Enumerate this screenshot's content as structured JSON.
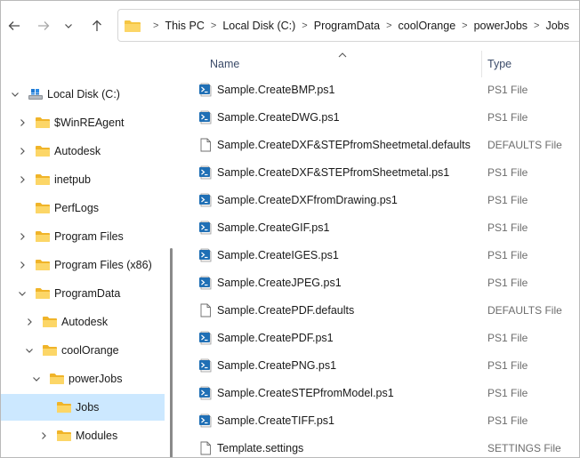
{
  "toolbar": {
    "back_icon": "arrow-left-icon",
    "forward_icon": "arrow-right-icon",
    "recent_icon": "chevron-down-icon",
    "up_icon": "arrow-up-icon"
  },
  "address": {
    "folder_icon": "folder-icon",
    "crumbs": [
      "This PC",
      "Local Disk (C:)",
      "ProgramData",
      "coolOrange",
      "powerJobs",
      "Jobs"
    ]
  },
  "nav": {
    "items": [
      {
        "label": "Local Disk (C:)",
        "icon": "drive-icon",
        "expanded": true
      },
      {
        "label": "$WinREAgent",
        "icon": "folder-icon"
      },
      {
        "label": "Autodesk",
        "icon": "folder-icon"
      },
      {
        "label": "inetpub",
        "icon": "folder-icon"
      },
      {
        "label": "PerfLogs",
        "icon": "folder-icon"
      },
      {
        "label": "Program Files",
        "icon": "folder-icon"
      },
      {
        "label": "Program Files (x86)",
        "icon": "folder-icon"
      },
      {
        "label": "ProgramData",
        "icon": "folder-icon",
        "expanded": true
      },
      {
        "label": "Autodesk",
        "icon": "folder-icon"
      },
      {
        "label": "coolOrange",
        "icon": "folder-icon",
        "expanded": true
      },
      {
        "label": "powerJobs",
        "icon": "folder-icon",
        "expanded": true
      },
      {
        "label": "Jobs",
        "icon": "folder-icon",
        "selected": true
      },
      {
        "label": "Modules",
        "icon": "folder-icon"
      }
    ]
  },
  "filelist": {
    "columns": {
      "name": "Name",
      "type": "Type"
    },
    "files": [
      {
        "name": "Sample.CreateBMP.ps1",
        "type": "PS1 File",
        "icon": "powershell-script-icon"
      },
      {
        "name": "Sample.CreateDWG.ps1",
        "type": "PS1 File",
        "icon": "powershell-script-icon"
      },
      {
        "name": "Sample.CreateDXF&STEPfromSheetmetal.defaults",
        "type": "DEFAULTS File",
        "icon": "blank-file-icon"
      },
      {
        "name": "Sample.CreateDXF&STEPfromSheetmetal.ps1",
        "type": "PS1 File",
        "icon": "powershell-script-icon"
      },
      {
        "name": "Sample.CreateDXFfromDrawing.ps1",
        "type": "PS1 File",
        "icon": "powershell-script-icon"
      },
      {
        "name": "Sample.CreateGIF.ps1",
        "type": "PS1 File",
        "icon": "powershell-script-icon"
      },
      {
        "name": "Sample.CreateIGES.ps1",
        "type": "PS1 File",
        "icon": "powershell-script-icon"
      },
      {
        "name": "Sample.CreateJPEG.ps1",
        "type": "PS1 File",
        "icon": "powershell-script-icon"
      },
      {
        "name": "Sample.CreatePDF.defaults",
        "type": "DEFAULTS File",
        "icon": "blank-file-icon"
      },
      {
        "name": "Sample.CreatePDF.ps1",
        "type": "PS1 File",
        "icon": "powershell-script-icon"
      },
      {
        "name": "Sample.CreatePNG.ps1",
        "type": "PS1 File",
        "icon": "powershell-script-icon"
      },
      {
        "name": "Sample.CreateSTEPfromModel.ps1",
        "type": "PS1 File",
        "icon": "powershell-script-icon"
      },
      {
        "name": "Sample.CreateTIFF.ps1",
        "type": "PS1 File",
        "icon": "powershell-script-icon"
      },
      {
        "name": "Template.settings",
        "type": "SETTINGS File",
        "icon": "blank-file-icon"
      }
    ]
  },
  "colors": {
    "selection": "#cce8ff",
    "folder": "#f5c542",
    "powershell": "#1f6fb5"
  }
}
